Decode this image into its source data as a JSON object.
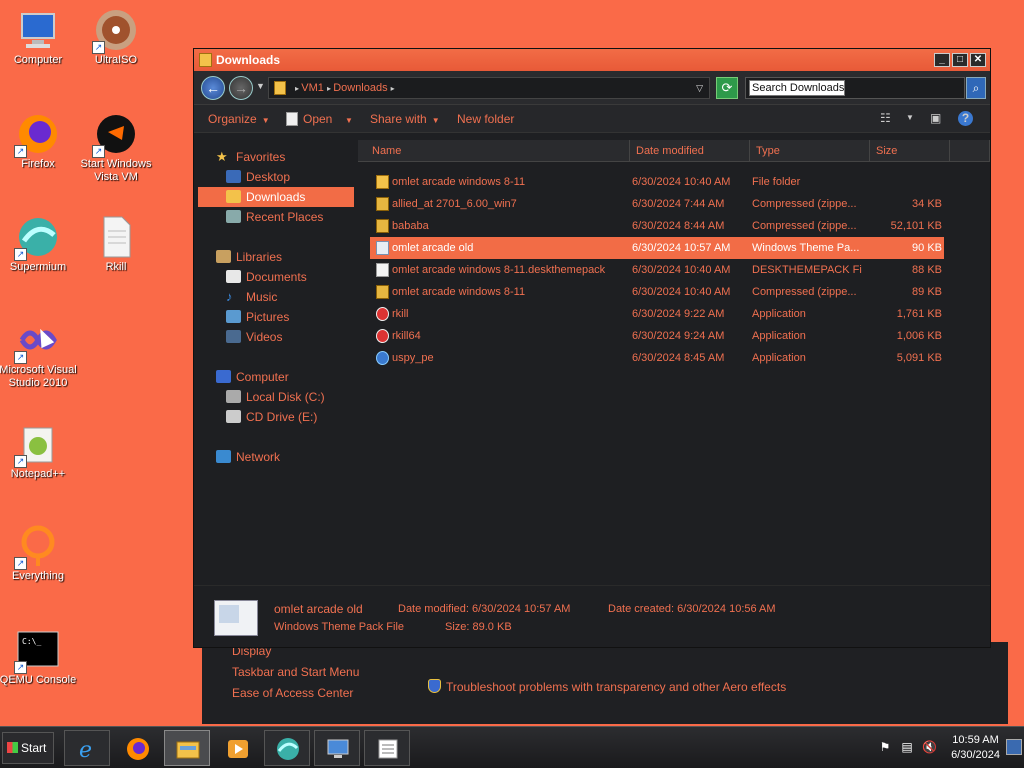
{
  "desktop": {
    "icons": [
      {
        "label": "Computer",
        "icon": "computer-icon"
      },
      {
        "label": "UltraISO",
        "icon": "disc-icon"
      },
      {
        "label": "Firefox",
        "icon": "firefox-icon"
      },
      {
        "label": "Start Windows Vista VM",
        "icon": "qemu-icon"
      },
      {
        "label": "Supermium",
        "icon": "supermium-icon"
      },
      {
        "label": "Rkill",
        "icon": "file-icon"
      },
      {
        "label": "Microsoft Visual Studio 2010",
        "icon": "visual-studio-icon"
      },
      {
        "label": "Notepad++",
        "icon": "notepadpp-icon"
      },
      {
        "label": "Everything",
        "icon": "everything-icon"
      },
      {
        "label": "QEMU Console",
        "icon": "console-icon"
      }
    ]
  },
  "background_window": {
    "links": [
      "Display",
      "Taskbar and Start Menu",
      "Ease of Access Center"
    ],
    "aero_link": "Troubleshoot problems with transparency and other Aero effects"
  },
  "explorer": {
    "title": "Downloads",
    "breadcrumb": [
      "VM1",
      "Downloads"
    ],
    "search_placeholder": "Search Downloads",
    "toolbar": {
      "organize": "Organize",
      "open": "Open",
      "share_with": "Share with",
      "new_folder": "New folder"
    },
    "nav": {
      "favorites": "Favorites",
      "desktop": "Desktop",
      "downloads": "Downloads",
      "recent_places": "Recent Places",
      "libraries": "Libraries",
      "documents": "Documents",
      "music": "Music",
      "pictures": "Pictures",
      "videos": "Videos",
      "computer": "Computer",
      "local_disk": "Local Disk (C:)",
      "cd_drive": "CD Drive (E:)",
      "network": "Network"
    },
    "columns": {
      "name": "Name",
      "date": "Date modified",
      "type": "Type",
      "size": "Size"
    },
    "files": [
      {
        "name": "omlet arcade windows 8-11",
        "date": "6/30/2024 10:40 AM",
        "type": "File folder",
        "size": "",
        "icon": "folder"
      },
      {
        "name": "allied_at 2701_6.00_win7",
        "date": "6/30/2024 7:44 AM",
        "type": "Compressed (zippe...",
        "size": "34 KB",
        "icon": "zip"
      },
      {
        "name": "bababa",
        "date": "6/30/2024 8:44 AM",
        "type": "Compressed (zippe...",
        "size": "52,101 KB",
        "icon": "zip"
      },
      {
        "name": "omlet arcade old",
        "date": "6/30/2024 10:57 AM",
        "type": "Windows Theme Pa...",
        "size": "90 KB",
        "icon": "theme"
      },
      {
        "name": "omlet arcade windows 8-11.deskthemepack",
        "date": "6/30/2024 10:40 AM",
        "type": "DESKTHEMEPACK File",
        "size": "88 KB",
        "icon": "doc"
      },
      {
        "name": "omlet arcade windows 8-11",
        "date": "6/30/2024 10:40 AM",
        "type": "Compressed (zippe...",
        "size": "89 KB",
        "icon": "zip"
      },
      {
        "name": "rkill",
        "date": "6/30/2024 9:22 AM",
        "type": "Application",
        "size": "1,761 KB",
        "icon": "app"
      },
      {
        "name": "rkill64",
        "date": "6/30/2024 9:24 AM",
        "type": "Application",
        "size": "1,006 KB",
        "icon": "app"
      },
      {
        "name": "uspy_pe",
        "date": "6/30/2024 8:45 AM",
        "type": "Application",
        "size": "5,091 KB",
        "icon": "globe"
      }
    ],
    "selected_index": 3,
    "details": {
      "name": "omlet arcade old",
      "type": "Windows Theme Pack File",
      "date_modified": "Date modified: 6/30/2024 10:57 AM",
      "date_created": "Date created: 6/30/2024 10:56 AM",
      "size": "Size: 89.0 KB"
    }
  },
  "taskbar": {
    "start_label": "Start",
    "time": "10:59 AM",
    "date": "6/30/2024"
  },
  "colors": {
    "accent": "#f26c46",
    "desktop": "#fa6a48",
    "window_bg": "#1e1f22"
  }
}
